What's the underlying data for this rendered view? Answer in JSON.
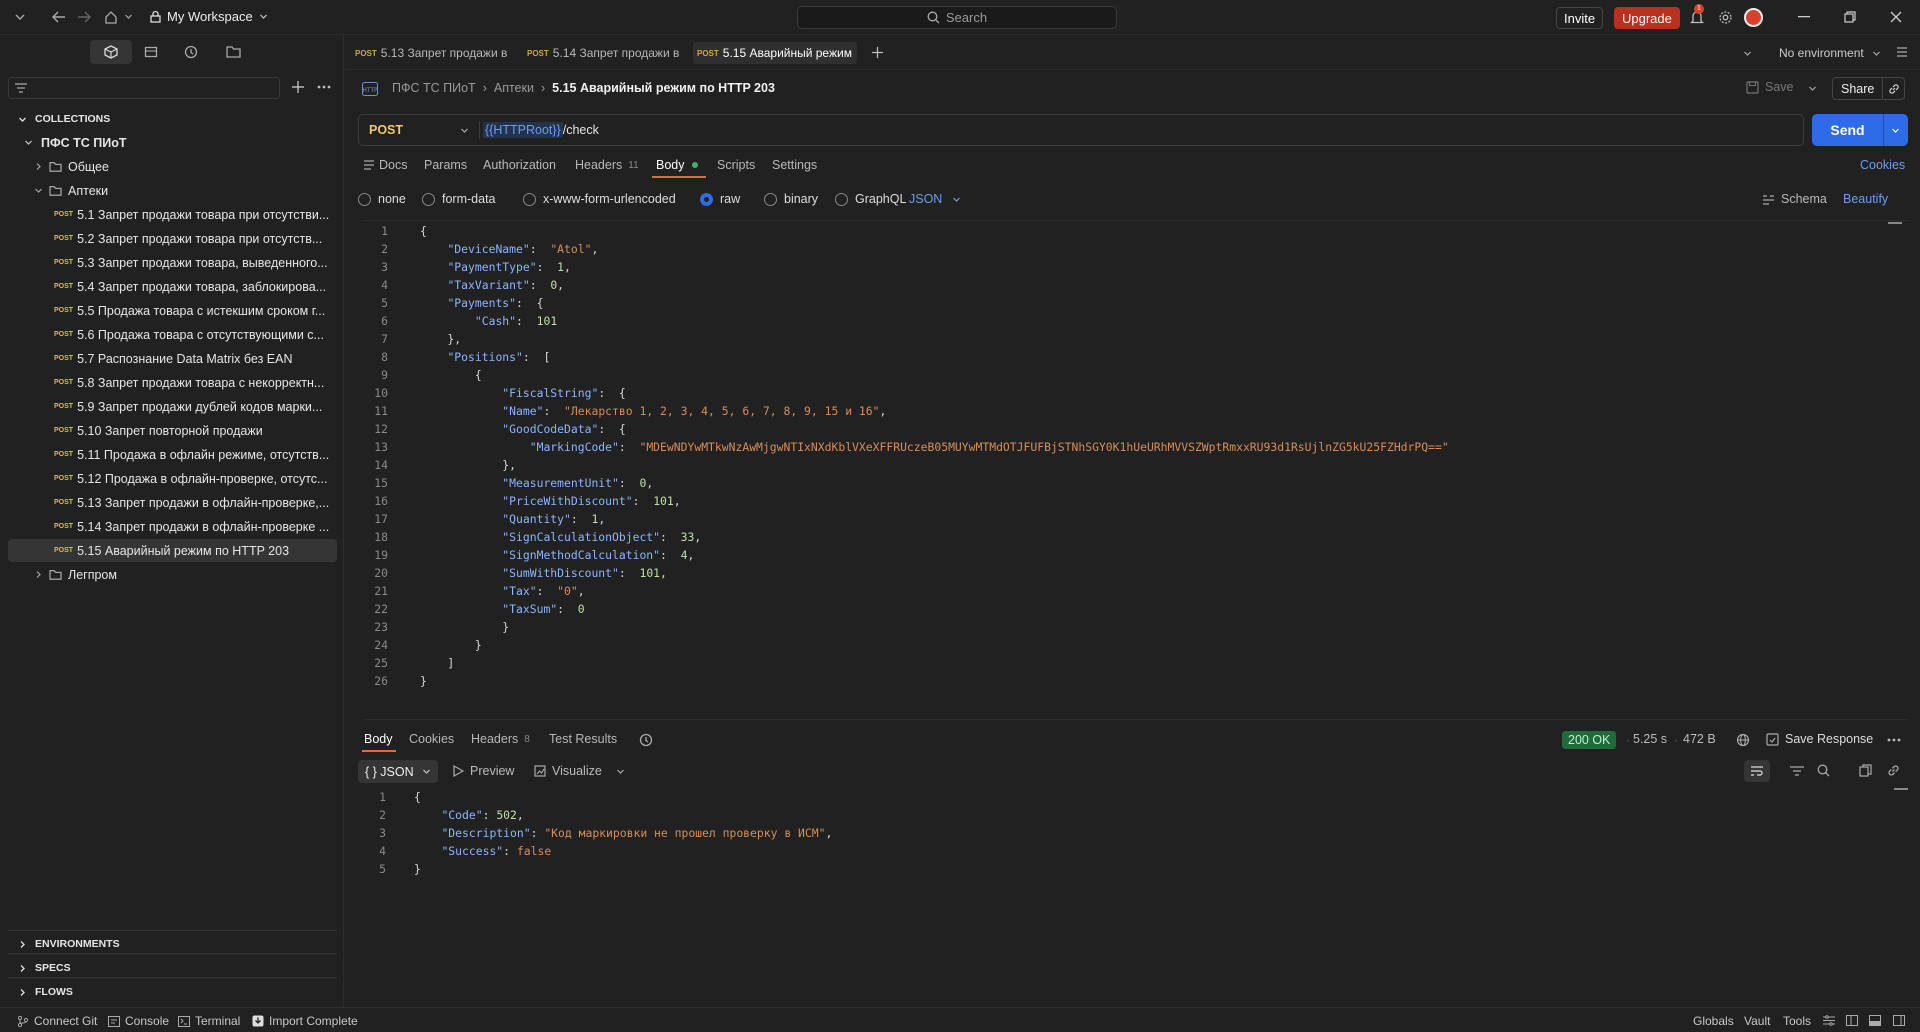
{
  "topbar": {
    "workspace": "My Workspace",
    "search_placeholder": "Search",
    "invite": "Invite",
    "upgrade": "Upgrade",
    "notif_count": "1",
    "environment": "No environment"
  },
  "sidebar": {
    "collections_label": "COLLECTIONS",
    "collection_name": "ПФС ТС ПИоТ",
    "folders": {
      "general": "Общее",
      "pharmacy": "Аптеки",
      "legprom": "Легпром"
    },
    "method_tag": "POST",
    "requests": [
      "5.1 Запрет продажи товара при отсутстви...",
      "5.2 Запрет продажи товара при отсутств...",
      "5.3 Запрет продажи товара, выведенного...",
      "5.4 Запрет продажи товара, заблокирова...",
      "5.5 Продажа товара с истекшим сроком г...",
      "5.6 Продажа товара с отсутствующими с...",
      "5.7 Распознание Data Matrix без EAN",
      "5.8 Запрет продажи товара с некорректн...",
      "5.9 Запрет продажи дублей кодов марки...",
      "5.10 Запрет повторной продажи",
      "5.11 Продажа в офлайн режиме, отсутств...",
      "5.12 Продажа в офлайн-проверке, отсутс...",
      "5.13 Запрет продажи в офлайн-проверке,...",
      "5.14 Запрет продажи в офлайн-проверке ...",
      "5.15 Аварийный режим по HTTP 203"
    ],
    "sections": [
      "ENVIRONMENTS",
      "SPECS",
      "FLOWS"
    ]
  },
  "tabs": [
    {
      "method": "POST",
      "label": "5.13 Запрет продажи в"
    },
    {
      "method": "POST",
      "label": "5.14 Запрет продажи в"
    },
    {
      "method": "POST",
      "label": "5.15 Аварийный режим"
    }
  ],
  "breadcrumb": {
    "collection": "ПФС ТС ПИоТ",
    "sep": "›",
    "folder": "Аптеки",
    "current": "5.15 Аварийный режим по HTTP 203",
    "save": "Save",
    "share": "Share"
  },
  "request": {
    "method": "POST",
    "url_var": "{{HTTPRoot}}",
    "url_path": " /check",
    "send": "Send"
  },
  "req_tabs": {
    "docs": "Docs",
    "params": "Params",
    "authorization": "Authorization",
    "headers": "Headers",
    "headers_count": "11",
    "body": "Body",
    "scripts": "Scripts",
    "settings": "Settings",
    "cookies": "Cookies"
  },
  "body_types": {
    "none": "none",
    "form_data": "form-data",
    "urlencoded": "x-www-form-urlencoded",
    "raw": "raw",
    "binary": "binary",
    "graphql": "GraphQL",
    "format": "JSON",
    "schema": "Schema",
    "beautify": "Beautify"
  },
  "request_body": [
    [
      [
        "p",
        "{"
      ]
    ],
    [
      [
        "p",
        "    "
      ],
      [
        "k",
        "\"DeviceName\""
      ],
      [
        "p",
        ":  "
      ],
      [
        "s",
        "\"Atol\""
      ],
      [
        "p",
        ","
      ]
    ],
    [
      [
        "p",
        "    "
      ],
      [
        "k",
        "\"PaymentType\""
      ],
      [
        "p",
        ":  "
      ],
      [
        "n",
        "1"
      ],
      [
        "p",
        ","
      ]
    ],
    [
      [
        "p",
        "    "
      ],
      [
        "k",
        "\"TaxVariant\""
      ],
      [
        "p",
        ":  "
      ],
      [
        "n",
        "0"
      ],
      [
        "p",
        ","
      ]
    ],
    [
      [
        "p",
        "    "
      ],
      [
        "k",
        "\"Payments\""
      ],
      [
        "p",
        ":  {"
      ]
    ],
    [
      [
        "p",
        "        "
      ],
      [
        "k",
        "\"Cash\""
      ],
      [
        "p",
        ":  "
      ],
      [
        "n",
        "101"
      ]
    ],
    [
      [
        "p",
        "    },"
      ]
    ],
    [
      [
        "p",
        "    "
      ],
      [
        "k",
        "\"Positions\""
      ],
      [
        "p",
        ":  ["
      ]
    ],
    [
      [
        "p",
        "        {"
      ]
    ],
    [
      [
        "p",
        "            "
      ],
      [
        "k",
        "\"FiscalString\""
      ],
      [
        "p",
        ":  {"
      ]
    ],
    [
      [
        "p",
        "            "
      ],
      [
        "k",
        "\"Name\""
      ],
      [
        "p",
        ":  "
      ],
      [
        "s",
        "\"Лекарство 1, 2, 3, 4, 5, 6, 7, 8, 9, 15 и 16\""
      ],
      [
        "p",
        ","
      ]
    ],
    [
      [
        "p",
        "            "
      ],
      [
        "k",
        "\"GoodCodeData\""
      ],
      [
        "p",
        ":  {"
      ]
    ],
    [
      [
        "p",
        "                "
      ],
      [
        "k",
        "\"MarkingCode\""
      ],
      [
        "p",
        ":  "
      ],
      [
        "s",
        "\"MDEwNDYwMTkwNzAwMjgwNTIxNXdKblVXeXFFRUczeB05MUYwMTMdOTJFUFBjSTNhSGY0K1hUeURhMVVSZWptRmxxRU93d1RsUjlnZG5kU25FZHdrPQ==\""
      ]
    ],
    [
      [
        "p",
        "            },"
      ]
    ],
    [
      [
        "p",
        "            "
      ],
      [
        "k",
        "\"MeasurementUnit\""
      ],
      [
        "p",
        ":  "
      ],
      [
        "n",
        "0"
      ],
      [
        "p",
        ","
      ]
    ],
    [
      [
        "p",
        "            "
      ],
      [
        "k",
        "\"PriceWithDiscount\""
      ],
      [
        "p",
        ":  "
      ],
      [
        "n",
        "101"
      ],
      [
        "p",
        ","
      ]
    ],
    [
      [
        "p",
        "            "
      ],
      [
        "k",
        "\"Quantity\""
      ],
      [
        "p",
        ":  "
      ],
      [
        "n",
        "1"
      ],
      [
        "p",
        ","
      ]
    ],
    [
      [
        "p",
        "            "
      ],
      [
        "k",
        "\"SignCalculationObject\""
      ],
      [
        "p",
        ":  "
      ],
      [
        "n",
        "33"
      ],
      [
        "p",
        ","
      ]
    ],
    [
      [
        "p",
        "            "
      ],
      [
        "k",
        "\"SignMethodCalculation\""
      ],
      [
        "p",
        ":  "
      ],
      [
        "n",
        "4"
      ],
      [
        "p",
        ","
      ]
    ],
    [
      [
        "p",
        "            "
      ],
      [
        "k",
        "\"SumWithDiscount\""
      ],
      [
        "p",
        ":  "
      ],
      [
        "n",
        "101"
      ],
      [
        "p",
        ","
      ]
    ],
    [
      [
        "p",
        "            "
      ],
      [
        "k",
        "\"Tax\""
      ],
      [
        "p",
        ":  "
      ],
      [
        "s",
        "\"0\""
      ],
      [
        "p",
        ","
      ]
    ],
    [
      [
        "p",
        "            "
      ],
      [
        "k",
        "\"TaxSum\""
      ],
      [
        "p",
        ":  "
      ],
      [
        "n",
        "0"
      ]
    ],
    [
      [
        "p",
        "            }"
      ]
    ],
    [
      [
        "p",
        "        }"
      ]
    ],
    [
      [
        "p",
        "    ]"
      ]
    ],
    [
      [
        "p",
        "}"
      ]
    ]
  ],
  "response": {
    "tabs": {
      "body": "Body",
      "cookies": "Cookies",
      "headers": "Headers",
      "headers_count": "8",
      "test_results": "Test Results"
    },
    "status": "200 OK",
    "time": "5.25 s",
    "size": "472 B",
    "save": "Save Response",
    "format": "{ } JSON",
    "preview": "Preview",
    "visualize": "Visualize",
    "lines": [
      [
        [
          "p",
          "{"
        ]
      ],
      [
        [
          "p",
          "    "
        ],
        [
          "k",
          "\"Code\""
        ],
        [
          "p",
          ": "
        ],
        [
          "n",
          "502"
        ],
        [
          "p",
          ","
        ]
      ],
      [
        [
          "p",
          "    "
        ],
        [
          "k",
          "\"Description\""
        ],
        [
          "p",
          ": "
        ],
        [
          "s",
          "\"Код маркировки не прошел проверку в ИСМ\""
        ],
        [
          "p",
          ","
        ]
      ],
      [
        [
          "p",
          "    "
        ],
        [
          "k",
          "\"Success\""
        ],
        [
          "p",
          ": "
        ],
        [
          "s",
          "false"
        ]
      ],
      [
        [
          "p",
          "}"
        ]
      ]
    ]
  },
  "footer": {
    "connect_git": "Connect Git",
    "console": "Console",
    "terminal": "Terminal",
    "import": "Import Complete",
    "globals": "Globals",
    "vault": "Vault",
    "tools": "Tools"
  },
  "colors": {
    "accent": "#2d6ce6",
    "upgrade": "#b8311f",
    "status_ok": "#1f6b3a",
    "post_tag": "#e8b93c"
  }
}
